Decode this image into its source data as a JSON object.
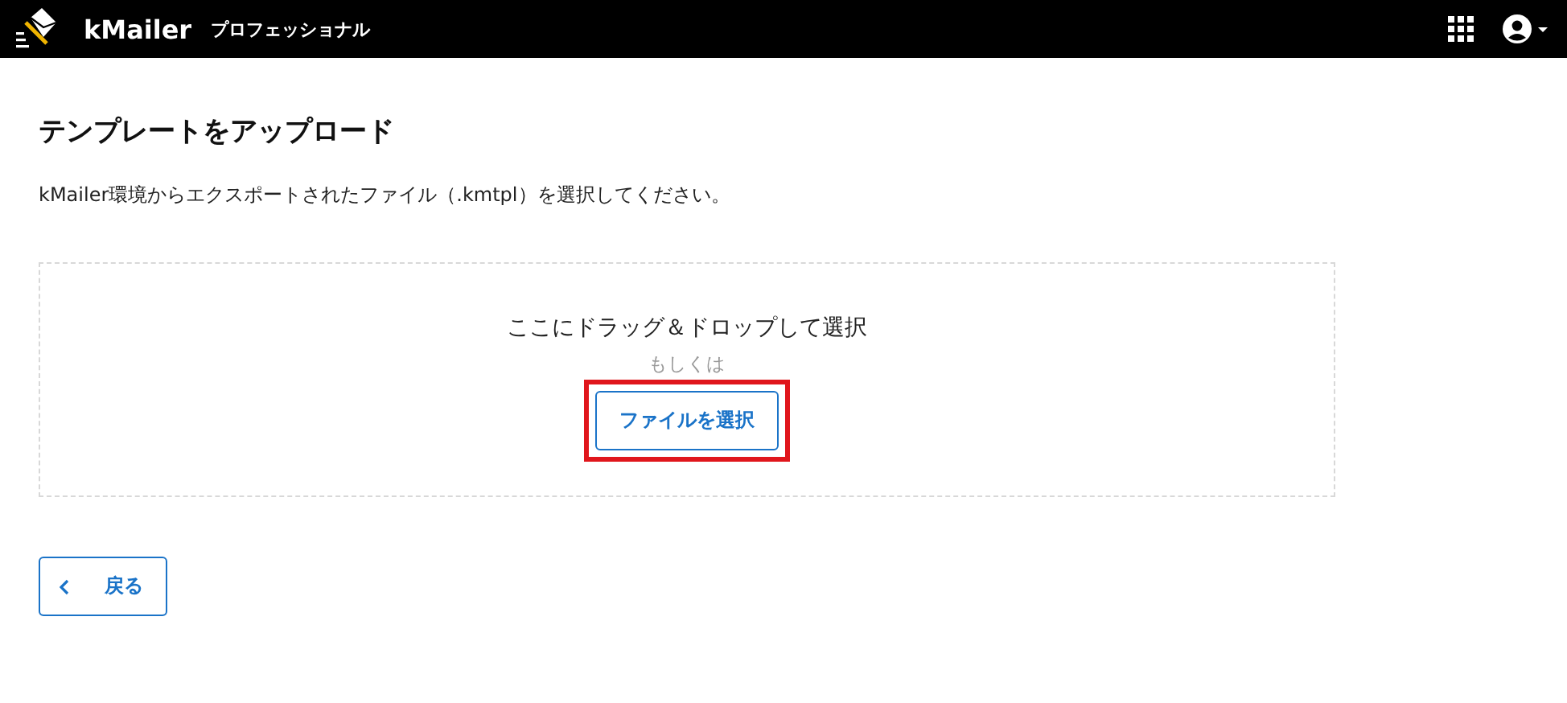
{
  "header": {
    "app_name": "kMailer",
    "edition": "プロフェッショナル"
  },
  "page": {
    "title": "テンプレートをアップロード",
    "description": "kMailer環境からエクスポートされたファイル（.kmtpl）を選択してください。"
  },
  "drop_zone": {
    "prompt": "ここにドラッグ＆ドロップして選択",
    "separator": "もしくは",
    "button": {
      "label": "ファイルを選択",
      "highlighted": true
    }
  },
  "back_button": {
    "label": "戻る"
  }
}
